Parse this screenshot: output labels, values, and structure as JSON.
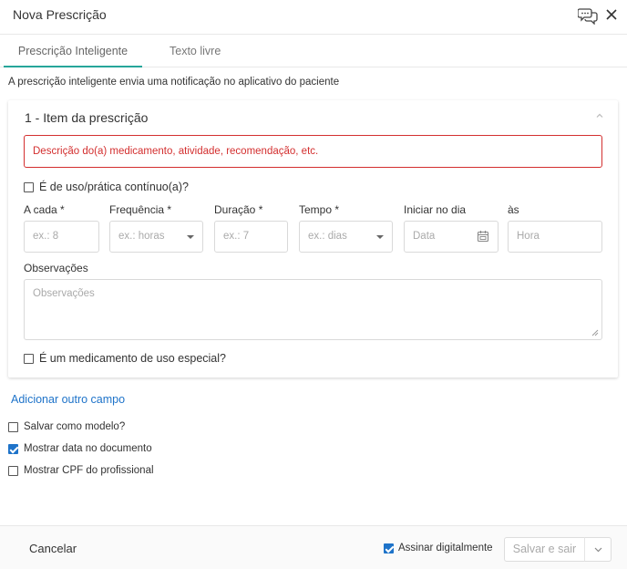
{
  "header": {
    "title": "Nova Prescrição"
  },
  "tabs": [
    {
      "label": "Prescrição Inteligente",
      "active": true
    },
    {
      "label": "Texto livre",
      "active": false
    }
  ],
  "notice": "A prescrição inteligente envia uma notificação no aplicativo do paciente",
  "item": {
    "title": "1 - Item da prescrição",
    "description_placeholder": "Descrição do(a) medicamento, atividade, recomendação, etc.",
    "continuous_label": "É de uso/prática contínuo(a)?",
    "continuous_checked": false,
    "fields": {
      "a_cada": {
        "label": "A cada *",
        "placeholder": "ex.: 8"
      },
      "frequencia": {
        "label": "Frequência *",
        "placeholder": "ex.: horas"
      },
      "duracao": {
        "label": "Duração *",
        "placeholder": "ex.: 7"
      },
      "tempo": {
        "label": "Tempo *",
        "placeholder": "ex.: dias"
      },
      "iniciar": {
        "label": "Iniciar no dia",
        "placeholder": "Data"
      },
      "as": {
        "label": "às",
        "placeholder": "Hora"
      }
    },
    "observacoes": {
      "label": "Observações",
      "placeholder": "Observações"
    },
    "special_label": "É um medicamento de uso especial?",
    "special_checked": false
  },
  "add_field_link": "Adicionar outro campo",
  "options": [
    {
      "label": "Salvar como modelo?",
      "checked": false
    },
    {
      "label": "Mostrar data no documento",
      "checked": true
    },
    {
      "label": "Mostrar CPF do profissional",
      "checked": false
    }
  ],
  "footer": {
    "cancel_label": "Cancelar",
    "sign_label": "Assinar digitalmente",
    "sign_checked": true,
    "save_label": "Salvar e sair"
  },
  "colors": {
    "accent": "#26a69a",
    "link": "#1e73c9",
    "error": "#d32f2f"
  }
}
